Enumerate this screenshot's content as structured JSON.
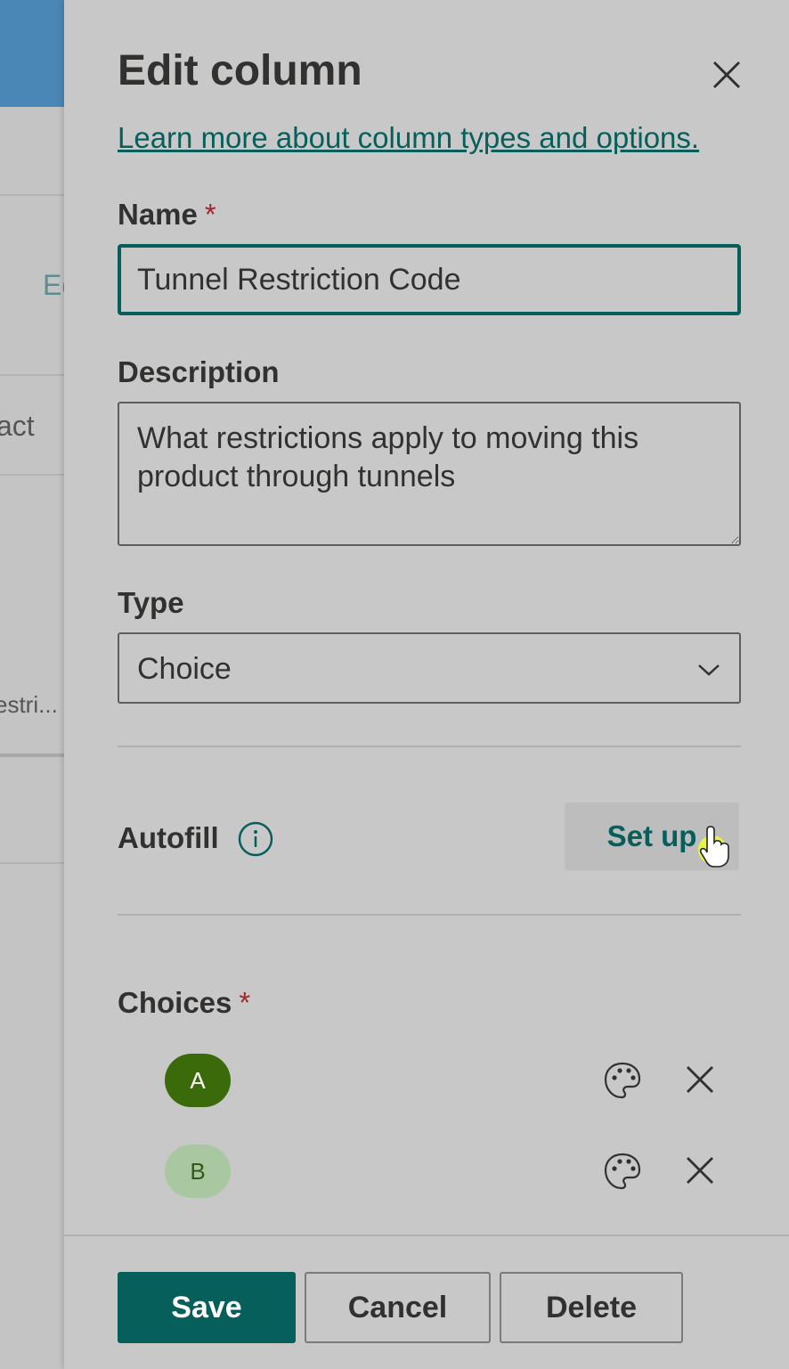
{
  "background": {
    "edit_fragment": "Ed",
    "act_fragment": "act",
    "restri_fragment": "estri..."
  },
  "panel": {
    "title": "Edit column",
    "learn_more_link": "Learn more about column types and options.",
    "name": {
      "label": "Name",
      "required_marker": "*",
      "value": "Tunnel Restriction Code"
    },
    "description": {
      "label": "Description",
      "value": "What restrictions apply to moving this product through tunnels"
    },
    "type": {
      "label": "Type",
      "selected": "Choice"
    },
    "autofill": {
      "label": "Autofill",
      "setup_button": "Set up"
    },
    "choices": {
      "label": "Choices",
      "required_marker": "*",
      "items": [
        {
          "label": "A",
          "color": "#3b6a0a"
        },
        {
          "label": "B",
          "color": "#a9c8a1"
        }
      ]
    },
    "footer": {
      "save": "Save",
      "cancel": "Cancel",
      "delete": "Delete"
    }
  },
  "colors": {
    "accent": "#075f5c",
    "required": "#a4262c"
  }
}
